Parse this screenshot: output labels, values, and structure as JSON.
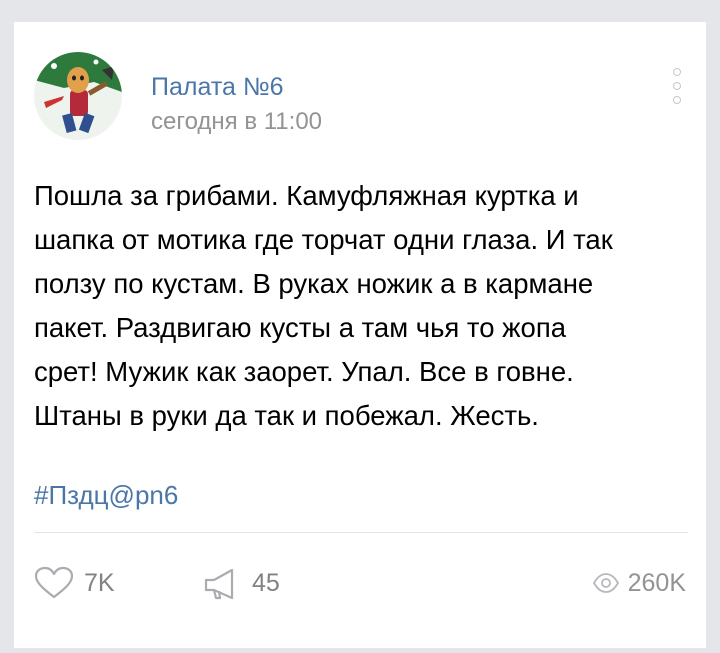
{
  "post": {
    "group_name": "Палата №6",
    "time": "сегодня в 11:00",
    "text_lines": [
      "Пошла за грибами. Камуфляжная куртка и",
      "шапка от мотика где торчат одни глаза. И так",
      "ползу по кустам. В руках ножик а в кармане",
      "пакет. Раздвигаю кусты а там чья то жопа",
      "срет! Мужик как заорет. Упал. Все в говне.",
      "Штаны в руки да так и побежал. Жесть."
    ],
    "hashtag": "#Пздц@pn6"
  },
  "footer": {
    "likes": "7K",
    "reposts": "45",
    "views": "260K"
  },
  "icons": {
    "avatar": "cartoon-character-avatar",
    "menu": "more-vertical-icon",
    "like": "heart-outline-icon",
    "share": "megaphone-icon",
    "views": "eye-icon"
  },
  "colors": {
    "link": "#4a76a8",
    "meta": "#939393",
    "icon": "#a9acb0"
  }
}
